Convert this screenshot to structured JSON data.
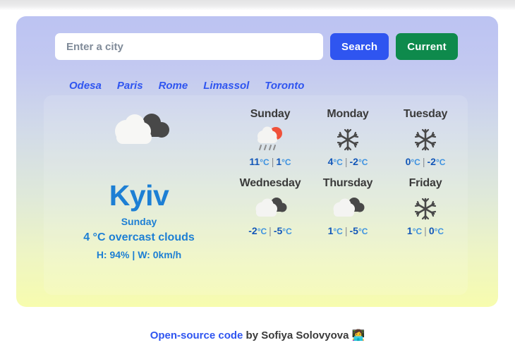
{
  "search": {
    "placeholder": "Enter a city",
    "value": "",
    "search_label": "Search",
    "current_label": "Current"
  },
  "quick_cities": [
    {
      "label": "Odesa"
    },
    {
      "label": "Paris"
    },
    {
      "label": "Rome"
    },
    {
      "label": "Limassol"
    },
    {
      "label": "Toronto"
    }
  ],
  "current": {
    "icon": "cloud-overcast-icon",
    "city": "Kyiv",
    "day": "Sunday",
    "description": "4 °C overcast clouds",
    "meta": "H: 94% | W: 0km/h"
  },
  "forecast": [
    {
      "day": "Sunday",
      "icon": "sun-rain-cloud-icon",
      "max": "11",
      "min": "1",
      "unit": "°C",
      "separator": "|"
    },
    {
      "day": "Monday",
      "icon": "snowflake-icon",
      "max": "4",
      "min": "-2",
      "unit": "°C",
      "separator": "|"
    },
    {
      "day": "Tuesday",
      "icon": "snowflake-icon",
      "max": "0",
      "min": "-2",
      "unit": "°C",
      "separator": "|"
    },
    {
      "day": "Wednesday",
      "icon": "cloud-overcast-icon",
      "max": "-2",
      "min": "-5",
      "unit": "°C",
      "separator": "|"
    },
    {
      "day": "Thursday",
      "icon": "cloud-overcast-icon",
      "max": "1",
      "min": "-5",
      "unit": "°C",
      "separator": "|"
    },
    {
      "day": "Friday",
      "icon": "snowflake-icon",
      "max": "1",
      "min": "0",
      "unit": "°C",
      "separator": "|"
    }
  ],
  "footer": {
    "link_label": "Open-source code",
    "text": " by Sofiya Solovyova ",
    "emoji": "👩‍💻"
  },
  "colors": {
    "accent_blue": "#2f55f0",
    "green": "#0e8a4c",
    "city_blue": "#1d7fd4",
    "card_top": "#bcc3f2",
    "card_bottom": "#f7fcae"
  }
}
